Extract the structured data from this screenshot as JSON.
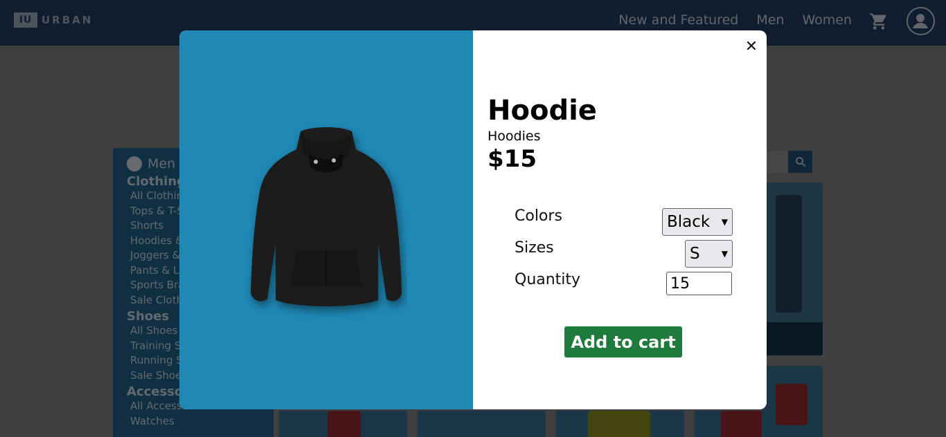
{
  "header": {
    "logo_mark": "IU",
    "logo_text": "URBAN",
    "nav": [
      "New and Featured",
      "Men",
      "Women"
    ],
    "cart_icon": "cart-icon",
    "account_icon": "account-icon"
  },
  "sidebar": {
    "gender": "Men",
    "groups": [
      {
        "title": "Clothing",
        "items": [
          "All Clothing",
          "Tops & T-Shirts",
          "Shorts",
          "Hoodies & Sweatshirts",
          "Joggers & Sweatpants",
          "Pants & Leggings",
          "Sports Bras",
          "Sale Clothing"
        ]
      },
      {
        "title": "Shoes",
        "items": [
          "All Shoes",
          "Training Shoes",
          "Running Shoes",
          "Sale Shoes"
        ]
      },
      {
        "title": "Accessories",
        "items": [
          "All Accessories",
          "Watches"
        ]
      }
    ]
  },
  "modal": {
    "close_symbol": "✕",
    "title": "Hoodie",
    "category": "Hoodies",
    "price": "$15",
    "options": {
      "colors_label": "Colors",
      "color_value": "Black",
      "sizes_label": "Sizes",
      "size_value": "S",
      "quantity_label": "Quantity",
      "quantity_value": "15"
    },
    "add_button": "Add to cart",
    "image_bg": "#1f88b5",
    "button_color": "#1f7a3d"
  }
}
